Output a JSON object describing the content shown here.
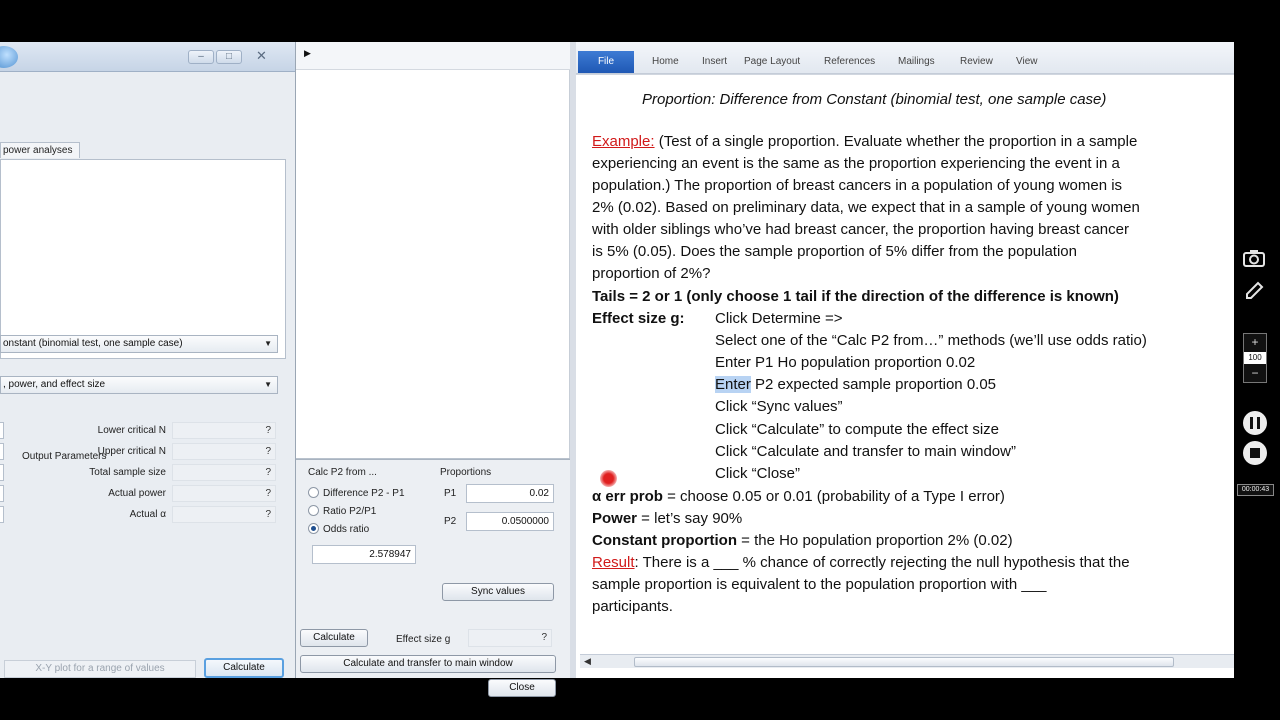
{
  "gpower_main": {
    "tab_label": "power analyses",
    "test_select": "onstant (binomial test, one sample case)",
    "analysis_select": ", power, and effect size",
    "output_header": "Output Parameters",
    "outputs": [
      {
        "label": "Lower critical N",
        "value": "?"
      },
      {
        "label": "Upper critical N",
        "value": "?"
      },
      {
        "label": "Total sample size",
        "value": "?"
      },
      {
        "label": "Actual power",
        "value": "?"
      },
      {
        "label": "Actual α",
        "value": "?"
      }
    ],
    "xy_plot_button": "X-Y plot for a range of values",
    "calculate_button": "Calculate"
  },
  "effect_dialog": {
    "calc_group_title": "Calc P2 from ...",
    "options": [
      {
        "label": "Difference P2 - P1",
        "selected": false
      },
      {
        "label": "Ratio P2/P1",
        "selected": false
      },
      {
        "label": "Odds ratio",
        "selected": true
      }
    ],
    "odds_ratio_value": "2.578947",
    "proportions_title": "Proportions",
    "p1_label": "P1",
    "p1_value": "0.02",
    "p2_label": "P2",
    "p2_value": "0.0500000",
    "sync_button": "Sync values",
    "calculate_button": "Calculate",
    "effect_size_label": "Effect size g",
    "effect_size_value": "?",
    "transfer_button": "Calculate and transfer to main window",
    "close_button": "Close"
  },
  "word": {
    "tabs": [
      "File",
      "Home",
      "Insert",
      "Page Layout",
      "References",
      "Mailings",
      "Review",
      "View"
    ],
    "heading": "Proportion: Difference from Constant (binomial test, one sample case)",
    "example_label": "Example:",
    "example_lines": [
      " (Test of a single proportion. Evaluate whether the proportion in a sample",
      "experiencing an event is the same as the proportion experiencing the event in a",
      "population.) The proportion of breast cancers in a population of young women is",
      "2% (0.02). Based on preliminary data, we expect that in a sample of young women",
      "with older siblings who’ve had breast cancer, the proportion having breast cancer",
      "is 5% (0.05). Does the sample proportion of 5% differ from the population",
      "proportion of 2%?"
    ],
    "tails_line": "Tails = 2 or 1 (only choose 1 tail if the direction of the difference is known)",
    "effect_label": "Effect size g:",
    "steps": [
      "Click Determine =>",
      "Select one of the “Calc P2 from…” methods (we’ll use odds ratio)",
      "Enter P1 Ho population proportion 0.02",
      "Enter",
      "Click “Sync values”",
      "Click “Calculate” to compute the effect size",
      "Click “Calculate and transfer to main window”",
      "Click “Close”"
    ],
    "step4_rest": " P2 expected sample proportion 0.05",
    "alpha_label": "α err prob",
    "alpha_rest": " = choose 0.05 or 0.01 (probability of a Type I error)",
    "power_label": "Power",
    "power_rest": " = let’s say 90%",
    "constant_label": "Constant proportion",
    "constant_rest": " = the Ho population proportion 2% (0.02)",
    "result_label": "Result",
    "result_line1": ": There is a ___ % chance of correctly rejecting the null hypothesis that the",
    "result_line2": "sample proportion is equivalent to the population proportion with ___",
    "result_line3": "participants."
  },
  "overlay": {
    "zoom_plus": "+",
    "zoom_value": "100",
    "zoom_minus": "−",
    "timestamp": "00:00:43"
  }
}
